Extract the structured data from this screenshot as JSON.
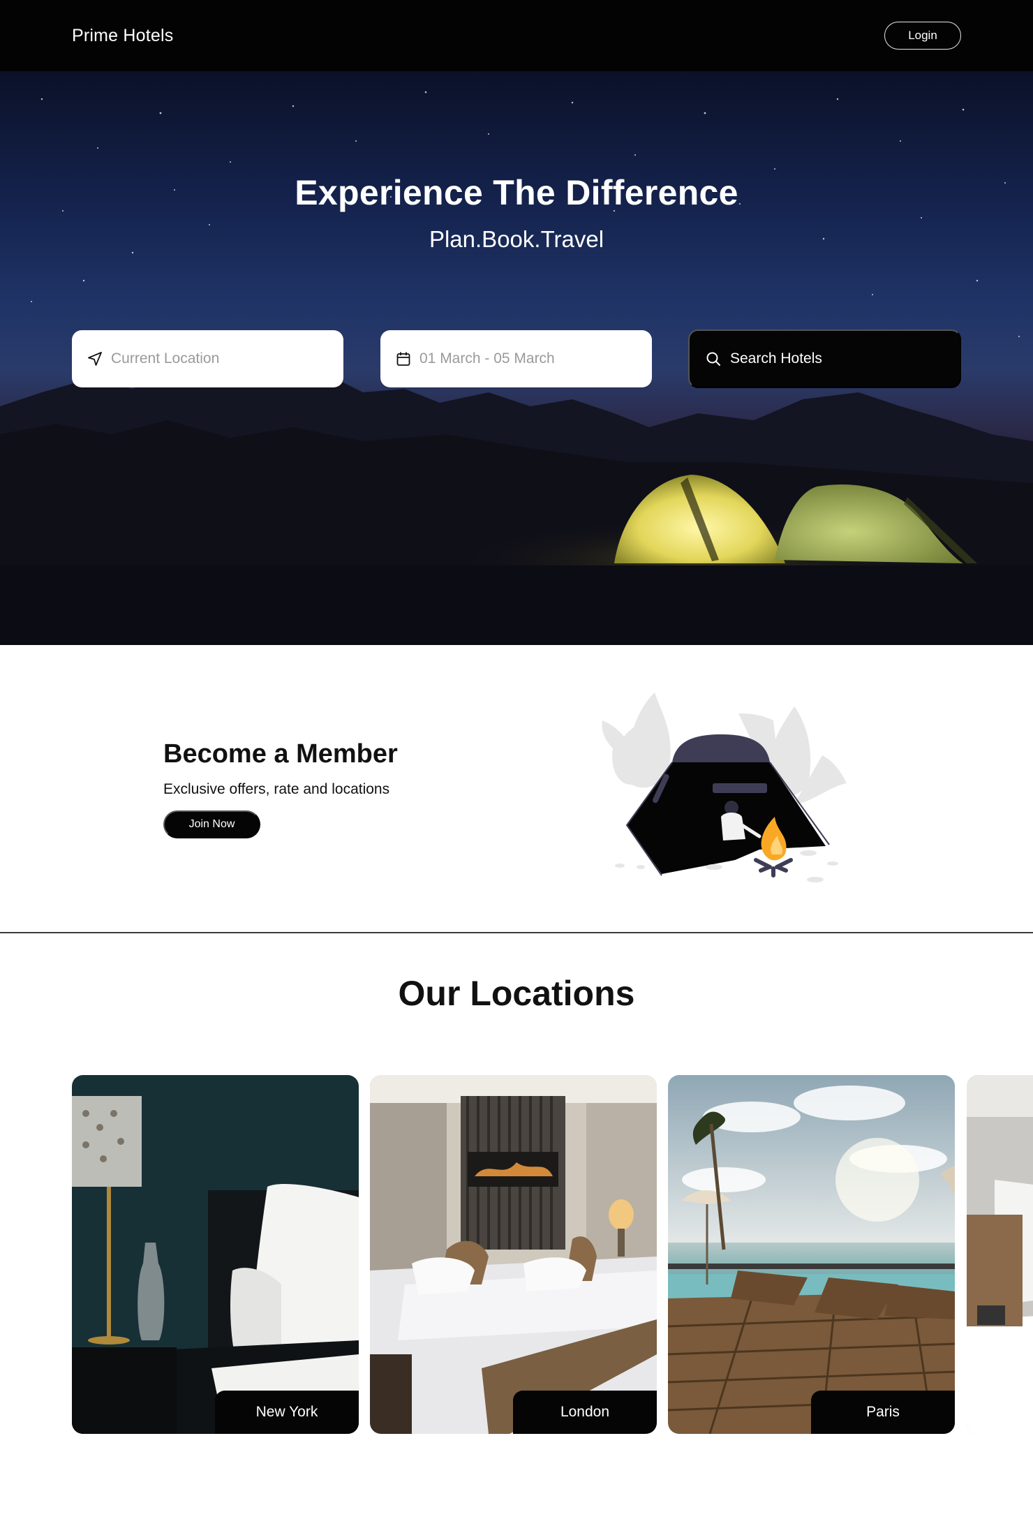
{
  "nav": {
    "brand": "Prime Hotels",
    "login_label": "Login"
  },
  "hero": {
    "title": "Experience The Difference",
    "subtitle": "Plan.Book.Travel",
    "location_placeholder": "Current Location",
    "date_placeholder": "01 March - 05 March",
    "search_label": "Search Hotels",
    "location_icon": "navigation-arrow-icon",
    "date_icon": "calendar-icon",
    "search_icon": "search-icon"
  },
  "member": {
    "title": "Become a Member",
    "subtitle": "Exclusive offers, rate and locations",
    "join_label": "Join Now"
  },
  "locations": {
    "title": "Our Locations",
    "cards": [
      {
        "label": "New York"
      },
      {
        "label": "London"
      },
      {
        "label": "Paris"
      }
    ]
  },
  "colors": {
    "nav_bg": "#030303",
    "button_dark": "#050505",
    "tent_yellow": "#e8e06a",
    "illustration_tent": "#3f3d56",
    "fire_orange": "#f9a826"
  }
}
